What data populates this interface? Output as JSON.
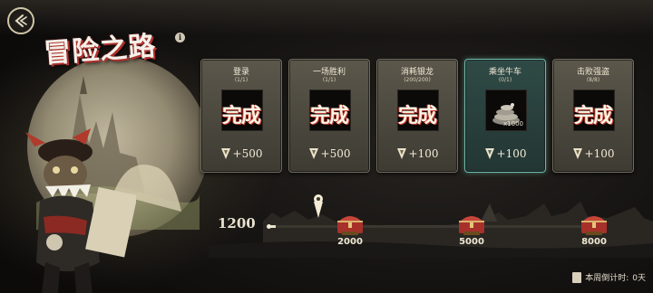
{
  "page": {
    "title": "冒险之路",
    "info_glyph": "i"
  },
  "cards": [
    {
      "title": "登录",
      "progress": "(1/1)",
      "state": "完成",
      "reward": "+500",
      "active": false
    },
    {
      "title": "一场胜利",
      "progress": "(1/1)",
      "state": "完成",
      "reward": "+500",
      "active": false
    },
    {
      "title": "消耗银龙",
      "progress": "(200/200)",
      "state": "完成",
      "reward": "+100",
      "active": false
    },
    {
      "title": "乘坐牛车",
      "progress": "(0/1)",
      "item_count": "x1000",
      "reward": "+100",
      "active": true
    },
    {
      "title": "击败强盗",
      "progress": "(8/8)",
      "state": "完成",
      "reward": "+100",
      "active": false
    }
  ],
  "track": {
    "current": "1200",
    "current_value": 1200,
    "max_value": 8000,
    "chests": [
      {
        "value": "2000",
        "amount": 2000
      },
      {
        "value": "5000",
        "amount": 5000
      },
      {
        "value": "8000",
        "amount": 8000
      }
    ]
  },
  "countdown": {
    "label": "本周倒计时:",
    "value": "0天"
  },
  "colors": {
    "accent_red": "#c03a2f",
    "active_teal": "#6fb7a7",
    "card_bg": "#4a463c",
    "text_cream": "#f2ead6"
  }
}
